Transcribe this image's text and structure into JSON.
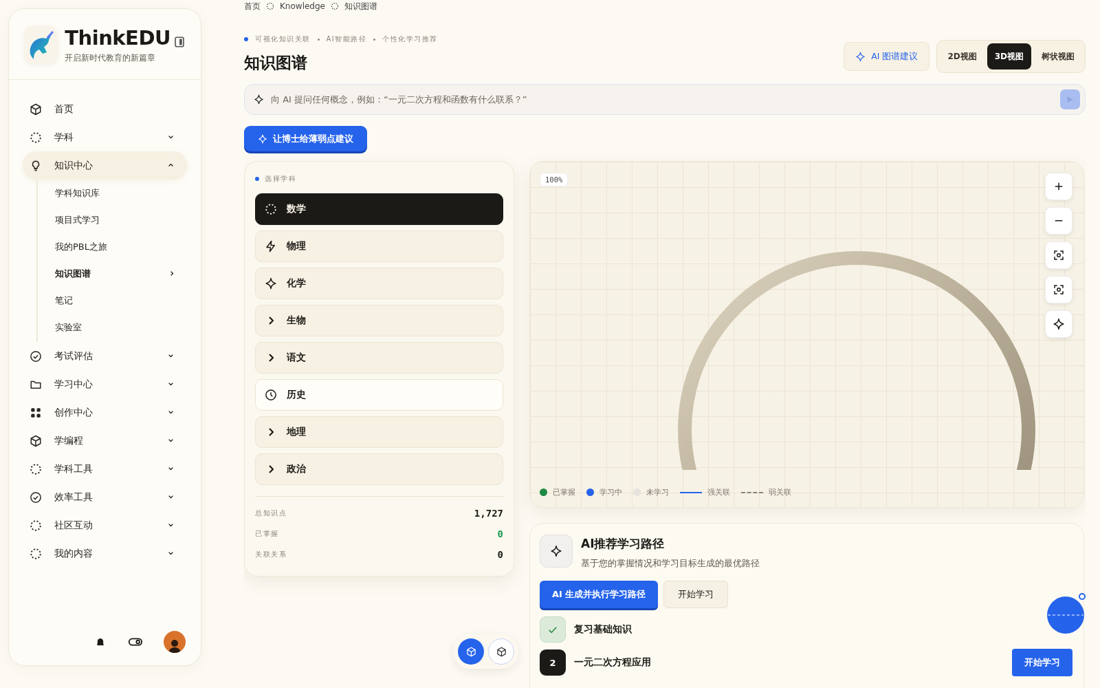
{
  "sidebar": {
    "brand": {
      "name": "ThinkEDU",
      "tagline": "开启新时代教育的新篇章"
    },
    "nav": [
      {
        "label": "首页",
        "kind": "link",
        "selected": false
      },
      {
        "label": "学科",
        "kind": "group",
        "selected": false,
        "expanded": false
      },
      {
        "label": "知识中心",
        "kind": "group",
        "selected": true,
        "expanded": true,
        "children": [
          {
            "label": "学科知识库",
            "selected": false
          },
          {
            "label": "项目式学习",
            "selected": false
          },
          {
            "label": "我的PBL之旅",
            "selected": false
          },
          {
            "label": "知识图谱",
            "selected": true
          },
          {
            "label": "笔记",
            "selected": false
          },
          {
            "label": "实验室",
            "selected": false
          }
        ]
      },
      {
        "label": "考试评估",
        "kind": "group",
        "selected": false,
        "expanded": false
      },
      {
        "label": "学习中心",
        "kind": "group",
        "selected": false,
        "expanded": false
      },
      {
        "label": "创作中心",
        "kind": "group",
        "selected": false,
        "expanded": false
      },
      {
        "label": "学编程",
        "kind": "group",
        "selected": false,
        "expanded": false
      },
      {
        "label": "学科工具",
        "kind": "group",
        "selected": false,
        "expanded": false
      },
      {
        "label": "效率工具",
        "kind": "group",
        "selected": false,
        "expanded": false
      },
      {
        "label": "社区互动",
        "kind": "group",
        "selected": false,
        "expanded": false
      },
      {
        "label": "我的内容",
        "kind": "group",
        "selected": false,
        "expanded": false
      }
    ]
  },
  "breadcrumb": [
    "首页",
    "Knowledge",
    "知识图谱"
  ],
  "header": {
    "tags": [
      "可视化知识关联",
      "AI智能路径",
      "个性化学习推荐"
    ],
    "title": "知识图谱",
    "ai_button": "AI 图谱建议",
    "view_tabs": [
      {
        "label": "2D视图",
        "selected": false
      },
      {
        "label": "3D视图",
        "selected": true
      },
      {
        "label": "树状视图",
        "selected": false
      }
    ],
    "ask": {
      "placeholder": "向 AI 提问任何概念，例如：“一元二次方程和函数有什么联系？”"
    },
    "weak_button": "让博士给薄弱点建议"
  },
  "subjects": {
    "heading": "选择学科",
    "items": [
      {
        "label": "数学",
        "selected": true,
        "hovered": false
      },
      {
        "label": "物理",
        "selected": false,
        "hovered": false
      },
      {
        "label": "化学",
        "selected": false,
        "hovered": false
      },
      {
        "label": "生物",
        "selected": false,
        "hovered": false
      },
      {
        "label": "语文",
        "selected": false,
        "hovered": false
      },
      {
        "label": "历史",
        "selected": false,
        "hovered": true
      },
      {
        "label": "地理",
        "selected": false,
        "hovered": false
      },
      {
        "label": "政治",
        "selected": false,
        "hovered": false
      }
    ],
    "stats": [
      {
        "label": "总知识点",
        "value": "1,727",
        "kind": "total"
      },
      {
        "label": "已掌握",
        "value": "0",
        "kind": "mastered"
      },
      {
        "label": "关联关系",
        "value": "0",
        "kind": "plain"
      }
    ]
  },
  "graph": {
    "zoom": "100%",
    "legend": [
      {
        "label": "已掌握",
        "kind": "dot",
        "color": "#1e8a45"
      },
      {
        "label": "学习中",
        "kind": "dot",
        "color": "#2563eb"
      },
      {
        "label": "未学习",
        "kind": "dot",
        "color": "#e6e3dc"
      },
      {
        "label": "强关联",
        "kind": "line",
        "color": "#2563eb"
      },
      {
        "label": "弱关联",
        "kind": "dashed",
        "color": "#8a857a"
      }
    ]
  },
  "path": {
    "title": "AI推荐学习路径",
    "subtitle": "基于您的掌握情况和学习目标生成的最优路径",
    "primary_button": "AI 生成并执行学习路径",
    "secondary_button": "开始学习",
    "steps": [
      {
        "label": "复习基础知识",
        "done": true
      },
      {
        "label": "一元二次方程应用",
        "done": false,
        "number": "2",
        "action": "开始学习"
      }
    ]
  }
}
